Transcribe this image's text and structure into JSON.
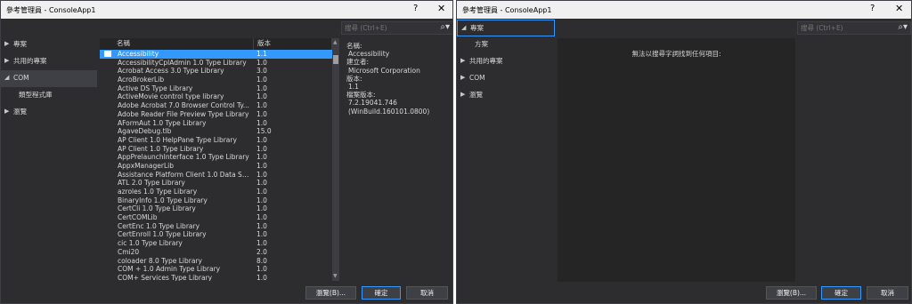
{
  "left": {
    "title": "參考管理員 - ConsoleApp1",
    "help": "?",
    "close": "✕",
    "search_placeholder": "搜尋 (Ctrl+E)",
    "nav": [
      {
        "label": "專案",
        "arrow": "▶"
      },
      {
        "label": "共用的專案",
        "arrow": "▶"
      },
      {
        "label": "COM",
        "arrow": "◢"
      },
      {
        "label": "類型程式庫",
        "arrow": ""
      },
      {
        "label": "瀏覽",
        "arrow": "▶"
      }
    ],
    "columns": {
      "name": "名稱",
      "version": "版本"
    },
    "rows": [
      {
        "name": "Accessibility",
        "version": "1.1"
      },
      {
        "name": "AccessibilityCplAdmin 1.0 Type Library",
        "version": "1.0"
      },
      {
        "name": "Acrobat Access 3.0 Type Library",
        "version": "3.0"
      },
      {
        "name": "AcroBrokerLib",
        "version": "1.0"
      },
      {
        "name": "Active DS Type Library",
        "version": "1.0"
      },
      {
        "name": "ActiveMovie control type library",
        "version": "1.0"
      },
      {
        "name": "Adobe Acrobat 7.0 Browser Control Ty...",
        "version": "1.0"
      },
      {
        "name": "Adobe Reader File Preview Type Library",
        "version": "1.0"
      },
      {
        "name": "AFormAut 1.0 Type Library",
        "version": "1.0"
      },
      {
        "name": "AgaveDebug.tlb",
        "version": "15.0"
      },
      {
        "name": "AP Client 1.0 HelpPane Type Library",
        "version": "1.0"
      },
      {
        "name": "AP Client 1.0 Type Library",
        "version": "1.0"
      },
      {
        "name": "AppPrelaunchInterface 1.0 Type Library",
        "version": "1.0"
      },
      {
        "name": "AppxManagerLib",
        "version": "1.0"
      },
      {
        "name": "Assistance Platform Client 1.0 Data Ser...",
        "version": "1.0"
      },
      {
        "name": "ATL 2.0 Type Library",
        "version": "1.0"
      },
      {
        "name": "azroles 1.0 Type Library",
        "version": "1.0"
      },
      {
        "name": "BinaryInfo 1.0 Type Library",
        "version": "1.0"
      },
      {
        "name": "CertCli 1.0 Type Library",
        "version": "1.0"
      },
      {
        "name": "CertCOMLib",
        "version": "1.0"
      },
      {
        "name": "CertEnc 1.0 Type Library",
        "version": "1.0"
      },
      {
        "name": "CertEnroll 1.0 Type Library",
        "version": "1.0"
      },
      {
        "name": "cic 1.0 Type Library",
        "version": "1.0"
      },
      {
        "name": "Cmi20",
        "version": "2.0"
      },
      {
        "name": "coloader 8.0 Type Library",
        "version": "8.0"
      },
      {
        "name": "COM + 1.0 Admin Type Library",
        "version": "1.0"
      },
      {
        "name": "COM+ Services Type Library",
        "version": "1.0"
      }
    ],
    "details": {
      "name_label": "名稱:",
      "name_value": "Accessibility",
      "creator_label": "建立者:",
      "creator_value": "Microsoft Corporation",
      "version_label": "版本:",
      "version_value": "1.1",
      "file_version_label": "檔案版本:",
      "file_version_value": "7.2.19041.746",
      "file_version_build": "(WinBuild.160101.0800)"
    },
    "buttons": {
      "browse": "瀏覽(B)...",
      "ok": "確定",
      "cancel": "取消"
    }
  },
  "right": {
    "title": "參考管理員 - ConsoleApp1",
    "help": "?",
    "close": "✕",
    "search_placeholder": "搜尋 (Ctrl+E)",
    "nav": [
      {
        "label": "專案",
        "arrow": "◢"
      },
      {
        "label": "方案",
        "arrow": ""
      },
      {
        "label": "共用的專案",
        "arrow": "▶"
      },
      {
        "label": "COM",
        "arrow": "▶"
      },
      {
        "label": "瀏覽",
        "arrow": "▶"
      }
    ],
    "empty_message": "無法以搜尋字詞找到任何項目:",
    "buttons": {
      "browse": "瀏覽(B)...",
      "ok": "確定",
      "cancel": "取消"
    }
  }
}
